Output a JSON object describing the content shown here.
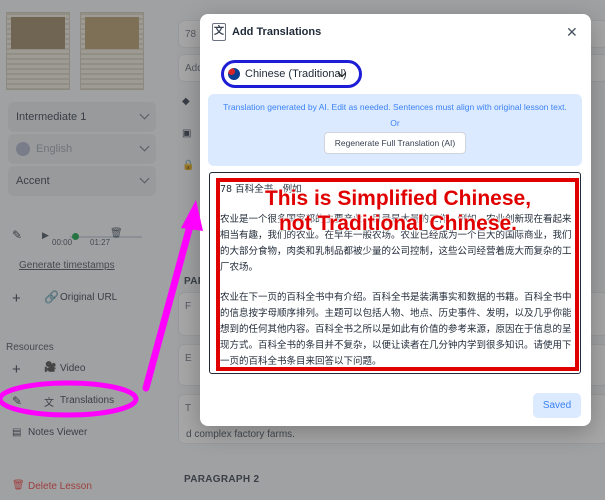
{
  "sidebar": {
    "level": "Intermediate 1",
    "language": "English",
    "accent": "Accent",
    "audio_current": "00:00",
    "audio_total": "01:27",
    "generate_timestamps": "Generate timestamps",
    "original_url": "Original URL",
    "resources_header": "Resources",
    "video": "Video",
    "translations": "Translations",
    "notes_viewer": "Notes Viewer",
    "delete_lesson": "Delete Lesson"
  },
  "main": {
    "field_top_value": "78",
    "field_add_partial": "Add",
    "paragraph_label_partial": "PAR",
    "paragraph_2_label": "PARAGRAPH 2",
    "side_letters": [
      "F",
      "s",
      "E",
      "s",
      "T"
    ],
    "bg_line_end": "d complex factory farms.",
    "right_edge_texts": [
      "1",
      "8",
      "8",
      "r",
      "us",
      "es,"
    ]
  },
  "modal": {
    "title": "Add Translations",
    "icon_glyph": "文",
    "close_glyph": "✕",
    "language_selected": "Chinese (Traditional)",
    "notice_text": "Translation generated by AI. Edit as needed. Sentences must align with original lesson text.",
    "notice_or": "Or",
    "regenerate_label": "Regenerate Full Translation (AI)",
    "editor_paragraphs": [
      "78 百科全书。例如",
      "农业是一个很多国家都的主要产业。目录是大量的工作。例如，农业创新现在看起来相当有趣，我们的农业。在早年一般农场。农业已经成为一个巨大的国际商业，我们的大部分食物，肉类和乳制品都被少量的公司控制，这些公司经营着庞大而复杂的工厂农场。",
      "农业在下一页的百科全书中有介绍。百科全书是装满事实和数据的书籍。百科全书中的信息按字母顺序排列。主题可以包括人物、地点、历史事件、发明，以及几乎你能想到的任何其他内容。百科全书之所以是如此有价值的参考来源，原因在于信息的呈现方式。百科全书的条目并不复杂，以便让读者在几分钟内学到很多知识。请使用下一页的百科全书条目来回答以下问题。"
    ],
    "callout_line1": "This is Simplified Chinese,",
    "callout_line2": "not Traditional Chinese.",
    "saved_label": "Saved"
  },
  "colors": {
    "annotation_magenta": "#ff00ff",
    "annotation_blue": "#1d1dd6",
    "annotation_red": "#e10000",
    "accent_blue": "#3b82f6"
  }
}
